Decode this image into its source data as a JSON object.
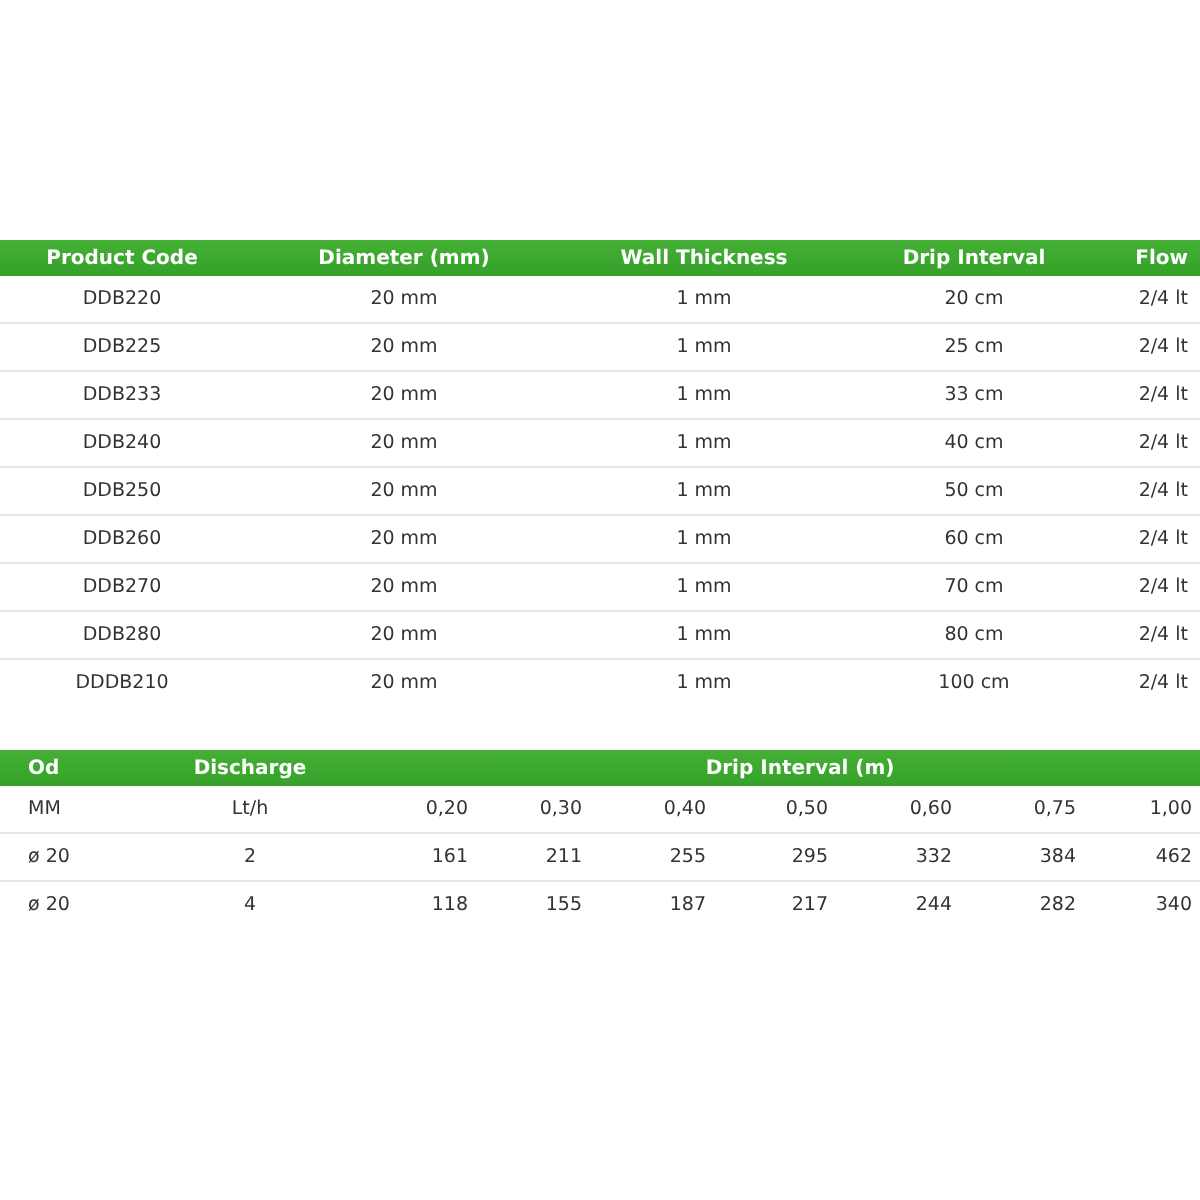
{
  "product_table": {
    "columns": [
      "Product Code",
      "Diameter (mm)",
      "Wall Thickness",
      "Drip Interval",
      "Flow"
    ],
    "rows": [
      [
        "DDB220",
        "20 mm",
        "1 mm",
        "20 cm",
        "2/4 lt"
      ],
      [
        "DDB225",
        "20 mm",
        "1 mm",
        "25 cm",
        "2/4 lt"
      ],
      [
        "DDB233",
        "20 mm",
        "1 mm",
        "33 cm",
        "2/4 lt"
      ],
      [
        "DDB240",
        "20 mm",
        "1 mm",
        "40 cm",
        "2/4 lt"
      ],
      [
        "DDB250",
        "20 mm",
        "1 mm",
        "50 cm",
        "2/4 lt"
      ],
      [
        "DDB260",
        "20 mm",
        "1 mm",
        "60 cm",
        "2/4 lt"
      ],
      [
        "DDB270",
        "20 mm",
        "1 mm",
        "70 cm",
        "2/4 lt"
      ],
      [
        "DDB280",
        "20 mm",
        "1 mm",
        "80 cm",
        "2/4 lt"
      ],
      [
        "DDDB210",
        "20 mm",
        "1 mm",
        "100 cm",
        "2/4 lt"
      ]
    ]
  },
  "discharge_table": {
    "columns": [
      "Od",
      "Discharge"
    ],
    "group_header": "Drip Interval (m)",
    "rows": [
      [
        "MM",
        "Lt/h",
        "0,20",
        "0,30",
        "0,40",
        "0,50",
        "0,60",
        "0,75",
        "1,00"
      ],
      [
        "ø 20",
        "2",
        "161",
        "211",
        "255",
        "295",
        "332",
        "384",
        "462"
      ],
      [
        "ø 20",
        "4",
        "118",
        "155",
        "187",
        "217",
        "244",
        "282",
        "340"
      ]
    ]
  }
}
